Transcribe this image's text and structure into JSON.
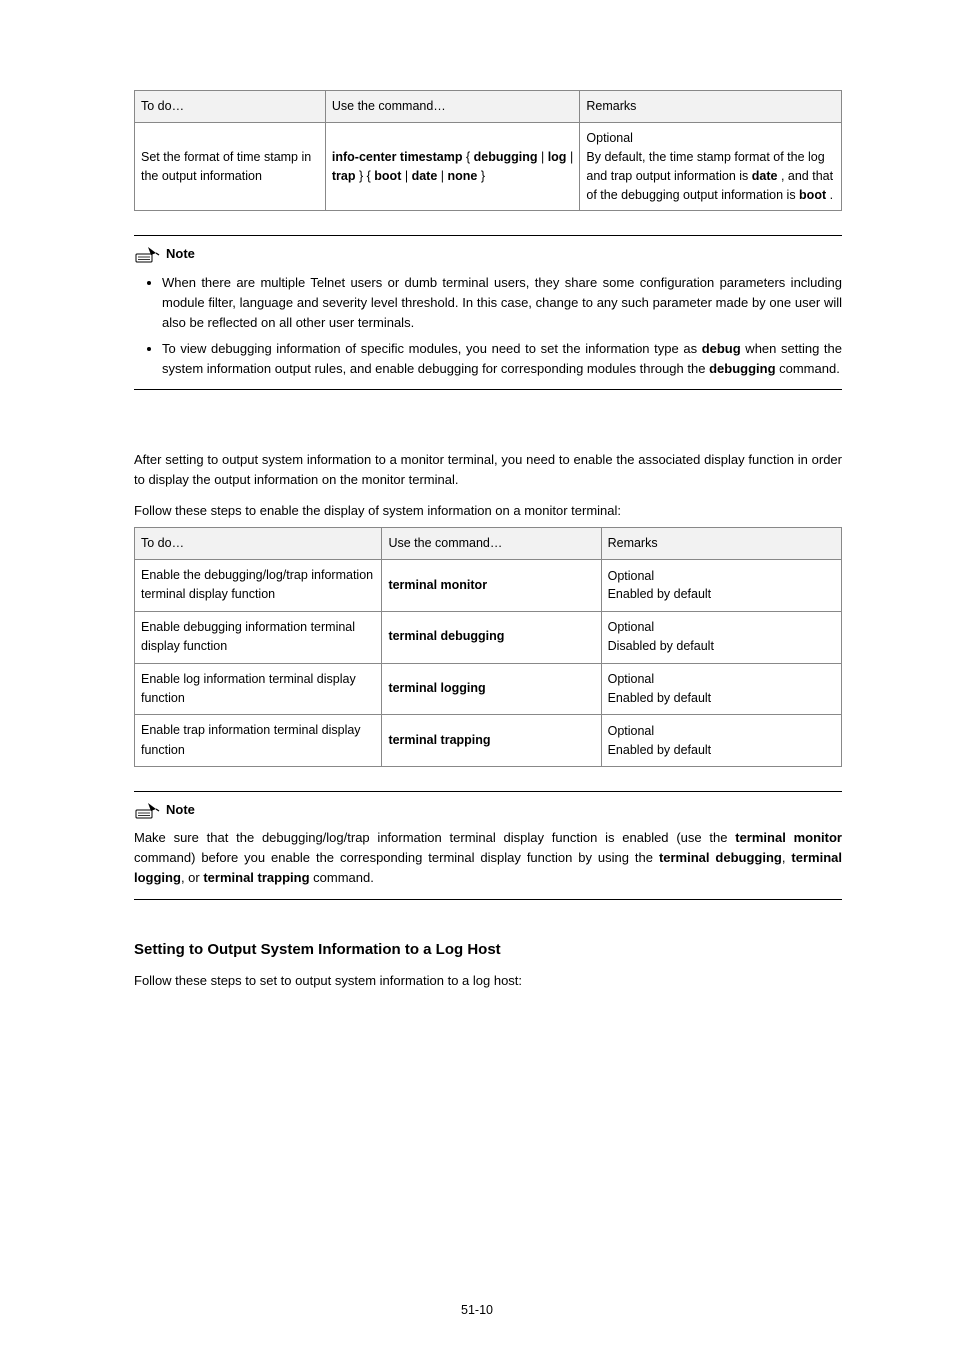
{
  "table1": {
    "headers": [
      "To do…",
      "Use the command…",
      "Remarks"
    ],
    "row": {
      "todo": "Set the format of time stamp in the output information",
      "cmd_prefix": "info-center timestamp",
      "cmd_group1_left": "{",
      "cmd_group1_a": "debugging",
      "cmd_group1_sep1": " | ",
      "cmd_group1_b": "log",
      "cmd_group1_sep2": " | ",
      "cmd_group1_c": "trap",
      "cmd_group1_right": " } { ",
      "cmd_group2_a": "boot",
      "cmd_group2_sep1": " | ",
      "cmd_group2_b": "date",
      "cmd_group2_sep2": " | ",
      "cmd_group2_c": "none",
      "cmd_group2_right": " }",
      "remarks_l1": "Optional",
      "remarks_l2a": "By default, the time stamp format of the log and trap output information is ",
      "remarks_l2b": "date",
      "remarks_l2c": ", and that of the debugging output information is ",
      "remarks_l3a": "boot",
      "remarks_l3b": "."
    }
  },
  "note1": {
    "title": "Note",
    "bullet1": "When there are multiple Telnet users or dumb terminal users, they share some configuration parameters including module filter, language and severity level threshold. In this case, change to any such parameter made by one user will also be reflected on all other user terminals.",
    "bullet2a": "To view debugging information of specific modules, you need to set the information type as ",
    "bullet2b": "debug",
    "bullet2c": " when setting the system information output rules, and enable debugging for corresponding modules through the ",
    "bullet2d": "debugging",
    "bullet2e": " command."
  },
  "mid": {
    "p1": "After setting to output system information to a monitor terminal, you need to enable the associated display function in order to display the output information on the monitor terminal.",
    "p2": "Follow these steps to enable the display of system information on a monitor terminal:"
  },
  "table2": {
    "headers": [
      "To do…",
      "Use the command…",
      "Remarks"
    ],
    "rows": [
      {
        "todo": "Enable the debugging/log/trap information terminal display function",
        "cmd": "terminal monitor",
        "r1": "Optional",
        "r2": "Enabled by default"
      },
      {
        "todo": "Enable debugging information terminal display function",
        "cmd": "terminal debugging",
        "r1": "Optional",
        "r2": "Disabled by default"
      },
      {
        "todo": "Enable log information terminal display function",
        "cmd": "terminal logging",
        "r1": "Optional",
        "r2": "Enabled by default"
      },
      {
        "todo": "Enable trap information terminal display function",
        "cmd": "terminal trapping",
        "r1": "Optional",
        "r2": "Enabled by default"
      }
    ]
  },
  "note2": {
    "title": "Note",
    "p1a": "Make sure that the debugging/log/trap information terminal display function is enabled (use the ",
    "p1b": "terminal monitor",
    "p1c": " command) before you enable the corresponding terminal display function by using the ",
    "p2a": "terminal debugging",
    "p2b": ", ",
    "p2c": "terminal logging",
    "p2d": ", or ",
    "p2e": "terminal trapping",
    "p2f": " command."
  },
  "heading": "Setting to Output System Information to a Log Host",
  "follow": "Follow these steps to set to output system information to a log host:",
  "footer": "51-10"
}
